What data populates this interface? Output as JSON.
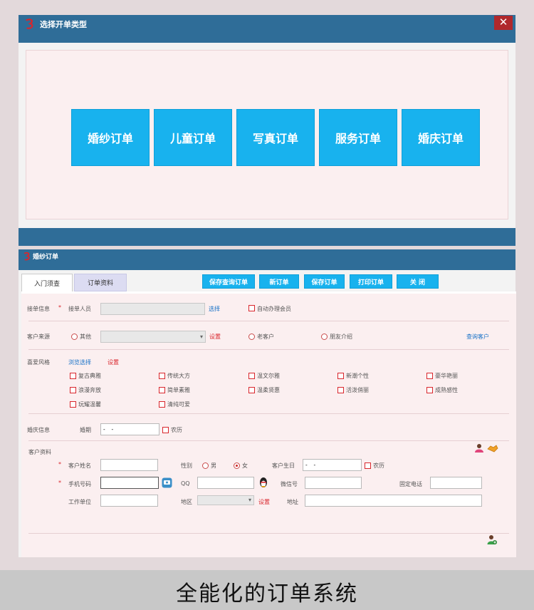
{
  "dialog": {
    "title": "选择开单类型",
    "close_label": "✕",
    "buttons": [
      "婚纱订单",
      "儿童订单",
      "写真订单",
      "服务订单",
      "婚庆订单"
    ]
  },
  "window": {
    "title": "婚纱订单",
    "tabs": [
      "入门须查",
      "订单资料"
    ],
    "toolbar": [
      "保存查询订单",
      "新订单",
      "保存订单",
      "打印订单",
      "关 闭"
    ]
  },
  "form": {
    "order_info": {
      "section": "接单信息",
      "required": "*",
      "receiver_label": "接单人员",
      "receiver_value": "",
      "select_link": "选择",
      "auto_member": "自动办理会员"
    },
    "source": {
      "section": "客户来源",
      "other": "其他",
      "setting": "设置",
      "old_customer": "老客户",
      "friend_ref": "朋友介绍",
      "search_customer": "查询客户"
    },
    "style": {
      "section": "喜爱风格",
      "browse_select": "浏览选择",
      "setting": "设置",
      "options": [
        "复古典雅",
        "传统大方",
        "温文尔雅",
        "新潮个性",
        "豪华艳丽",
        "浪漫奔放",
        "简单素雅",
        "温柔贤惠",
        "活泼俏丽",
        "成熟感性",
        "玩耀温馨",
        "清纯可爱"
      ]
    },
    "wedding": {
      "section": "婚庆信息",
      "date_label": "婚期",
      "date_value": "-    -",
      "lunar": "农历"
    },
    "customer": {
      "section": "客户资料",
      "required": "*",
      "name_label": "客户姓名",
      "gender_label": "性别",
      "male": "男",
      "female": "女",
      "birthday_label": "客户生日",
      "birthday_value": "-    -",
      "lunar": "农历",
      "phone_label": "手机号码",
      "qq_label": "QQ",
      "wechat_label": "微信号",
      "landline_label": "固定电话",
      "work_label": "工作单位",
      "region_label": "地区",
      "region_setting": "设置",
      "address_label": "地址"
    }
  },
  "caption": "全能化的订单系统",
  "colors": {
    "title_bar": "#2f6d98",
    "big_button": "#18b2ee",
    "close": "#b0282c",
    "form_bg": "#fbeff0"
  }
}
